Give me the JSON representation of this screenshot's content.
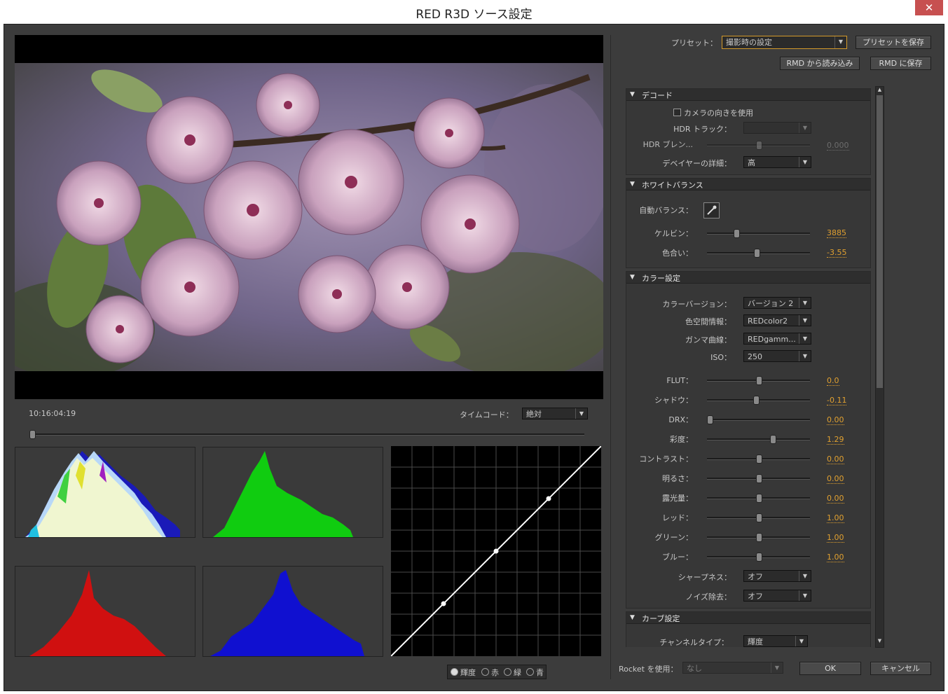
{
  "window": {
    "title": "RED R3D ソース設定",
    "close_glyph": "✕"
  },
  "preview": {
    "timecode": "10:16:04:19",
    "timecode_label": "タイムコード：",
    "timecode_mode": "絶対",
    "scrub_position": 0.0
  },
  "preset": {
    "label": "プリセット：",
    "value": "撮影時の設定",
    "save_button": "プリセットを保存",
    "rmd_load_button": "RMD から読み込み",
    "rmd_save_button": "RMD に保存"
  },
  "decode": {
    "header": "デコード",
    "camera_orientation": "カメラの向きを使用",
    "hdr_track_label": "HDR トラック：",
    "hdr_blend_label": "HDR ブレン...",
    "hdr_blend_value": "0.000",
    "debayer_label": "デベイヤーの詳細：",
    "debayer_value": "高"
  },
  "white_balance": {
    "header": "ホワイトバランス",
    "auto_label": "自動バランス：",
    "kelvin_label": "ケルビン：",
    "kelvin_value": "3885",
    "kelvin_pos": 0.27,
    "tint_label": "色合い：",
    "tint_value": "-3.55",
    "tint_pos": 0.48
  },
  "color": {
    "header": "カラー設定",
    "dropdowns": [
      {
        "label": "カラーバージョン：",
        "value": "バージョン 2"
      },
      {
        "label": "色空間情報：",
        "value": "REDcolor2"
      },
      {
        "label": "ガンマ曲線：",
        "value": "REDgamm..."
      },
      {
        "label": "ISO：",
        "value": "250"
      }
    ],
    "sliders": [
      {
        "label": "FLUT：",
        "value": "0.0",
        "pos": 0.5
      },
      {
        "label": "シャドウ：",
        "value": "-0.11",
        "pos": 0.47
      },
      {
        "label": "DRX：",
        "value": "0.00",
        "pos": 0.0
      },
      {
        "label": "彩度：",
        "value": "1.29",
        "pos": 0.64
      },
      {
        "label": "コントラスト：",
        "value": "0.00",
        "pos": 0.5
      },
      {
        "label": "明るさ：",
        "value": "0.00",
        "pos": 0.5
      },
      {
        "label": "露光量：",
        "value": "0.00",
        "pos": 0.5
      },
      {
        "label": "レッド：",
        "value": "1.00",
        "pos": 0.5
      },
      {
        "label": "グリーン：",
        "value": "1.00",
        "pos": 0.5
      },
      {
        "label": "ブルー：",
        "value": "1.00",
        "pos": 0.5
      }
    ],
    "sharpness_label": "シャープネス：",
    "sharpness_value": "オフ",
    "noise_label": "ノイズ除去：",
    "noise_value": "オフ"
  },
  "curve": {
    "header": "カーブ設定",
    "channel_label": "チャンネルタイプ：",
    "channel_value": "輝度"
  },
  "curve_channels": [
    "輝度",
    "赤",
    "緑",
    "青"
  ],
  "footer": {
    "rocket_label": "Rocket を使用：",
    "rocket_value": "なし",
    "ok_button": "OK",
    "cancel_button": "キャンセル"
  }
}
